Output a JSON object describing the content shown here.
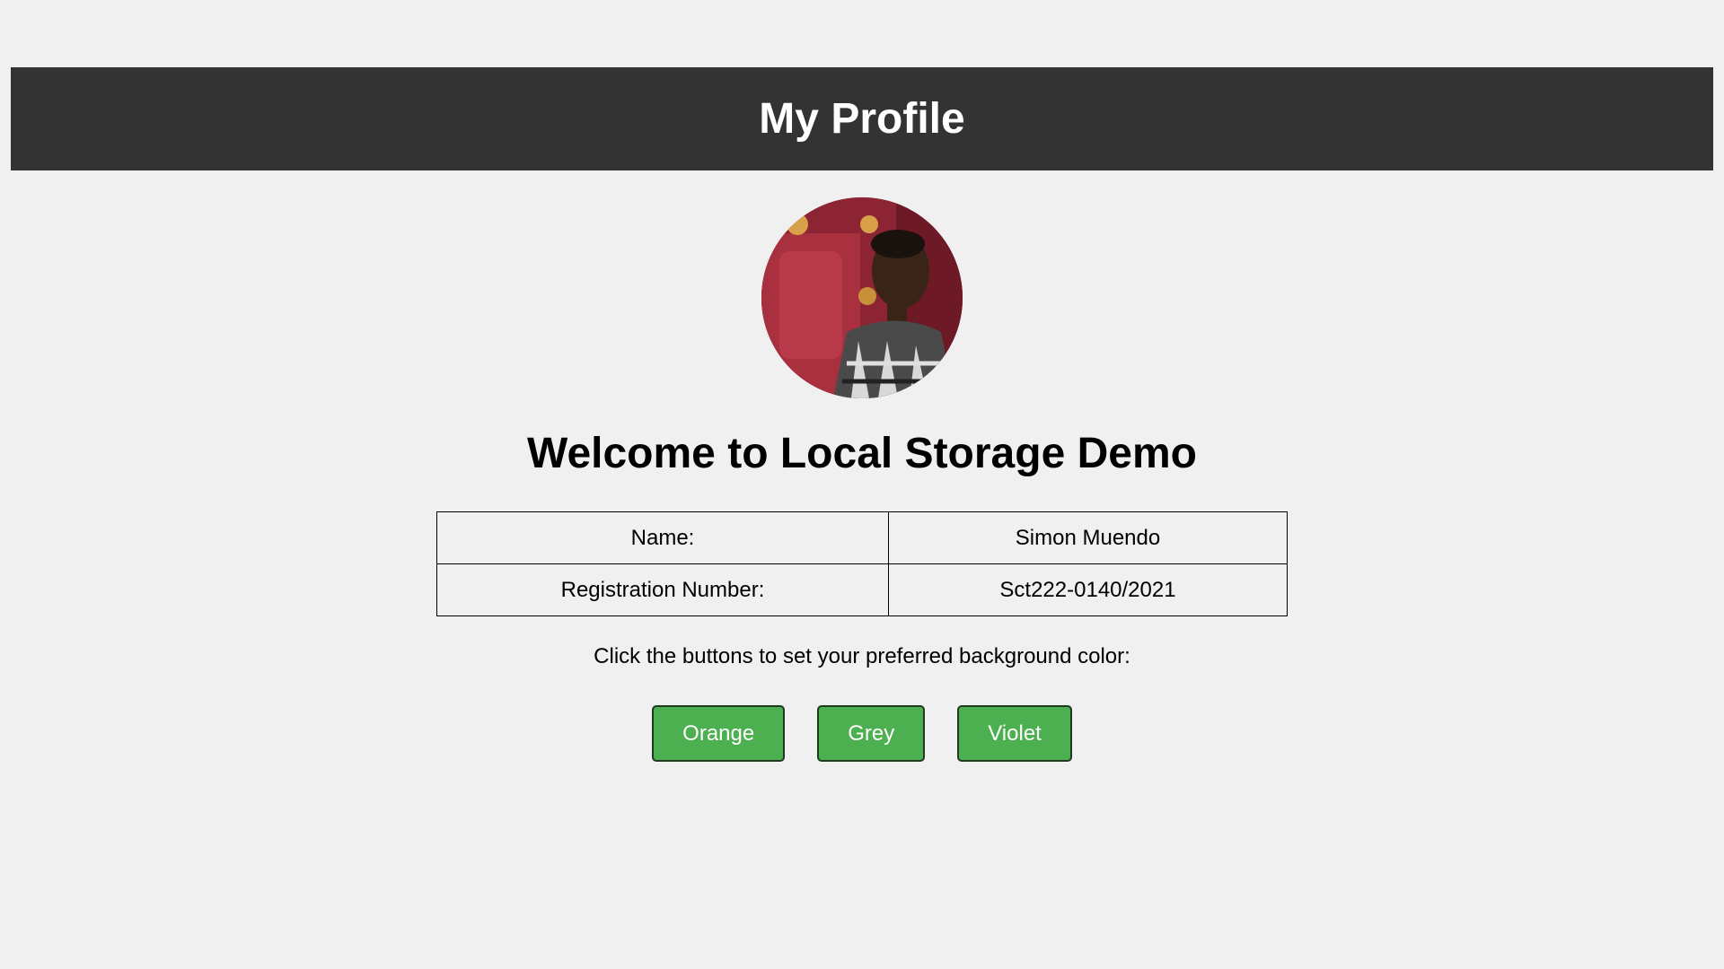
{
  "header": {
    "title": "My Profile"
  },
  "welcome": {
    "heading": "Welcome to Local Storage Demo"
  },
  "profile": {
    "rows": [
      {
        "label": "Name:",
        "value": "Simon Muendo"
      },
      {
        "label": "Registration Number:",
        "value": "Sct222-0140/2021"
      }
    ]
  },
  "instructions": "Click the buttons to set your preferred background color:",
  "color_buttons": [
    {
      "label": "Orange"
    },
    {
      "label": "Grey"
    },
    {
      "label": "Violet"
    }
  ],
  "colors": {
    "header_bg": "#333333",
    "page_bg": "#f0f0f0",
    "button_bg": "#4caf50"
  }
}
